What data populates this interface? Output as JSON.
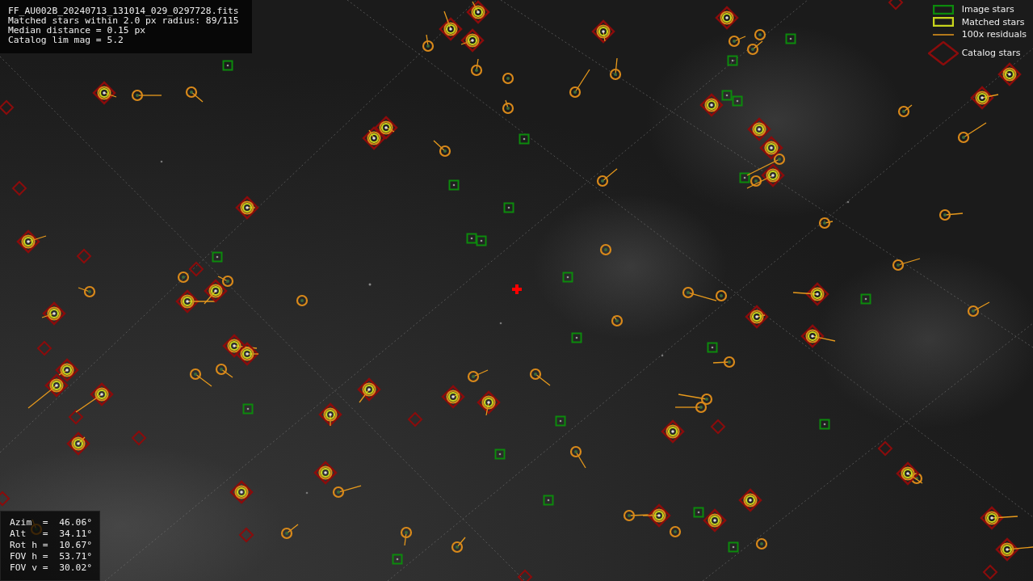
{
  "header": {
    "lines": [
      "FF_AU002B_20240713_131014_029_0297728.fits",
      "Matched stars within 2.0 px radius: 89/115",
      "Median distance = 0.15 px",
      "Catalog lim mag = 5.2"
    ]
  },
  "legend": [
    {
      "label": "Image stars"
    },
    {
      "kind": "matched",
      "label": "Matched stars"
    },
    {
      "kind": "residual",
      "label": "100x residuals"
    },
    {
      "kind": "catalog",
      "label": "Catalog stars"
    }
  ],
  "pointing": {
    "lines": [
      "Azim  =  46.06°",
      "Alt   =  34.11°",
      "Rot h =  10.67°",
      "FOV h =  53.71°",
      "FOV v =  30.02°"
    ]
  }
}
